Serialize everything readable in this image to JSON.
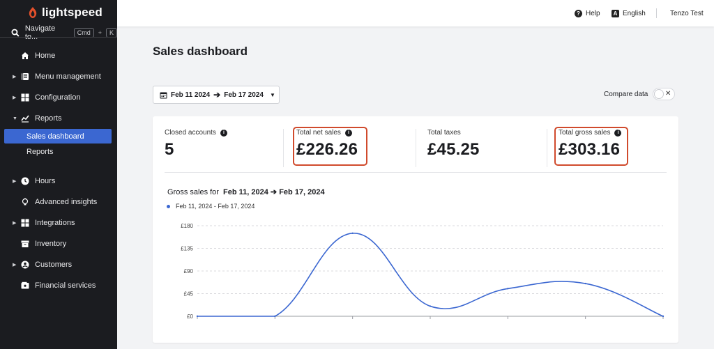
{
  "brand": {
    "name": "lightspeed",
    "color": "#e4502b"
  },
  "search": {
    "label": "Navigate to...",
    "key1": "Cmd",
    "plus": "+",
    "key2": "K"
  },
  "sidebar": {
    "items": [
      {
        "label": "Home",
        "icon": "home-icon",
        "caret": false
      },
      {
        "label": "Menu management",
        "icon": "menu-book-icon",
        "caret": true
      },
      {
        "label": "Configuration",
        "icon": "grid-icon",
        "caret": true
      },
      {
        "label": "Reports",
        "icon": "chart-line-icon",
        "caret": true,
        "expanded": true
      },
      {
        "label": "Hours",
        "icon": "clock-icon",
        "caret": true
      },
      {
        "label": "Advanced insights",
        "icon": "lightbulb-icon",
        "caret": false
      },
      {
        "label": "Integrations",
        "icon": "grid-icon",
        "caret": true
      },
      {
        "label": "Inventory",
        "icon": "box-icon",
        "caret": false
      },
      {
        "label": "Customers",
        "icon": "user-icon",
        "caret": true
      },
      {
        "label": "Financial services",
        "icon": "wallet-icon",
        "caret": false
      }
    ],
    "sub_items": [
      {
        "label": "Sales dashboard",
        "active": true
      },
      {
        "label": "Reports",
        "active": false
      }
    ]
  },
  "topbar": {
    "help": "Help",
    "language": "English",
    "user": "Tenzo Test"
  },
  "page": {
    "title": "Sales dashboard",
    "date_start": "Feb 11 2024",
    "date_end": "Feb 17 2024",
    "compare_label": "Compare data"
  },
  "metrics": [
    {
      "label": "Closed accounts",
      "value": "5"
    },
    {
      "label": "Total net sales",
      "value": "£226.26"
    },
    {
      "label": "Total taxes",
      "value": "£45.25"
    },
    {
      "label": "Total gross sales",
      "value": "£303.16"
    }
  ],
  "chart": {
    "title_prefix": "Gross sales for",
    "title_start": "Feb 11, 2024",
    "title_end": "Feb 17, 2024",
    "legend": "Feb 11, 2024 - Feb 17, 2024"
  },
  "chart_data": {
    "type": "line",
    "title": "Gross sales for Feb 11, 2024 → Feb 17, 2024",
    "series": [
      {
        "name": "Feb 11, 2024 - Feb 17, 2024",
        "color": "#3b67d1",
        "values": [
          0,
          0,
          165,
          20,
          55,
          65,
          0
        ]
      }
    ],
    "yticks": [
      "£0",
      "£45",
      "£90",
      "£135",
      "£180"
    ],
    "ylim": [
      0,
      180
    ],
    "grid": true
  }
}
